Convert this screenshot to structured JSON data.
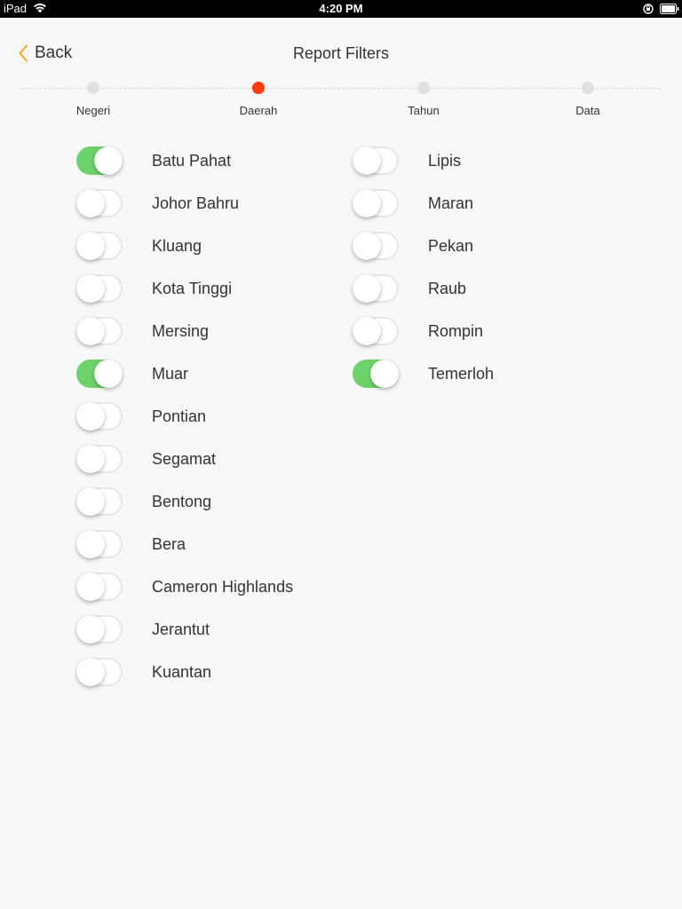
{
  "status_bar": {
    "carrier": "iPad",
    "time": "4:20 PM",
    "wifi_icon": "wifi-icon",
    "lock_icon": "rotation-lock-icon",
    "battery_icon": "battery-icon"
  },
  "nav": {
    "back_label": "Back",
    "back_icon": "chevron-left-icon",
    "title": "Report Filters",
    "accent_color": "#f5a623"
  },
  "steps": [
    {
      "label": "Negeri",
      "active": false
    },
    {
      "label": "Daerah",
      "active": true
    },
    {
      "label": "Tahun",
      "active": false
    },
    {
      "label": "Data",
      "active": false
    }
  ],
  "colors": {
    "active_step": "#ff3b0a",
    "toggle_on": "#6cd36a",
    "inactive_step": "#e0e0e0"
  },
  "districts_left": [
    {
      "label": "Batu Pahat",
      "on": true
    },
    {
      "label": "Johor Bahru",
      "on": false
    },
    {
      "label": "Kluang",
      "on": false
    },
    {
      "label": "Kota Tinggi",
      "on": false
    },
    {
      "label": "Mersing",
      "on": false
    },
    {
      "label": "Muar",
      "on": true
    },
    {
      "label": "Pontian",
      "on": false
    },
    {
      "label": "Segamat",
      "on": false
    },
    {
      "label": "Bentong",
      "on": false
    },
    {
      "label": "Bera",
      "on": false
    },
    {
      "label": "Cameron Highlands",
      "on": false
    },
    {
      "label": "Jerantut",
      "on": false
    },
    {
      "label": "Kuantan",
      "on": false
    }
  ],
  "districts_right": [
    {
      "label": "Lipis",
      "on": false
    },
    {
      "label": "Maran",
      "on": false
    },
    {
      "label": "Pekan",
      "on": false
    },
    {
      "label": "Raub",
      "on": false
    },
    {
      "label": "Rompin",
      "on": false
    },
    {
      "label": "Temerloh",
      "on": true
    }
  ]
}
